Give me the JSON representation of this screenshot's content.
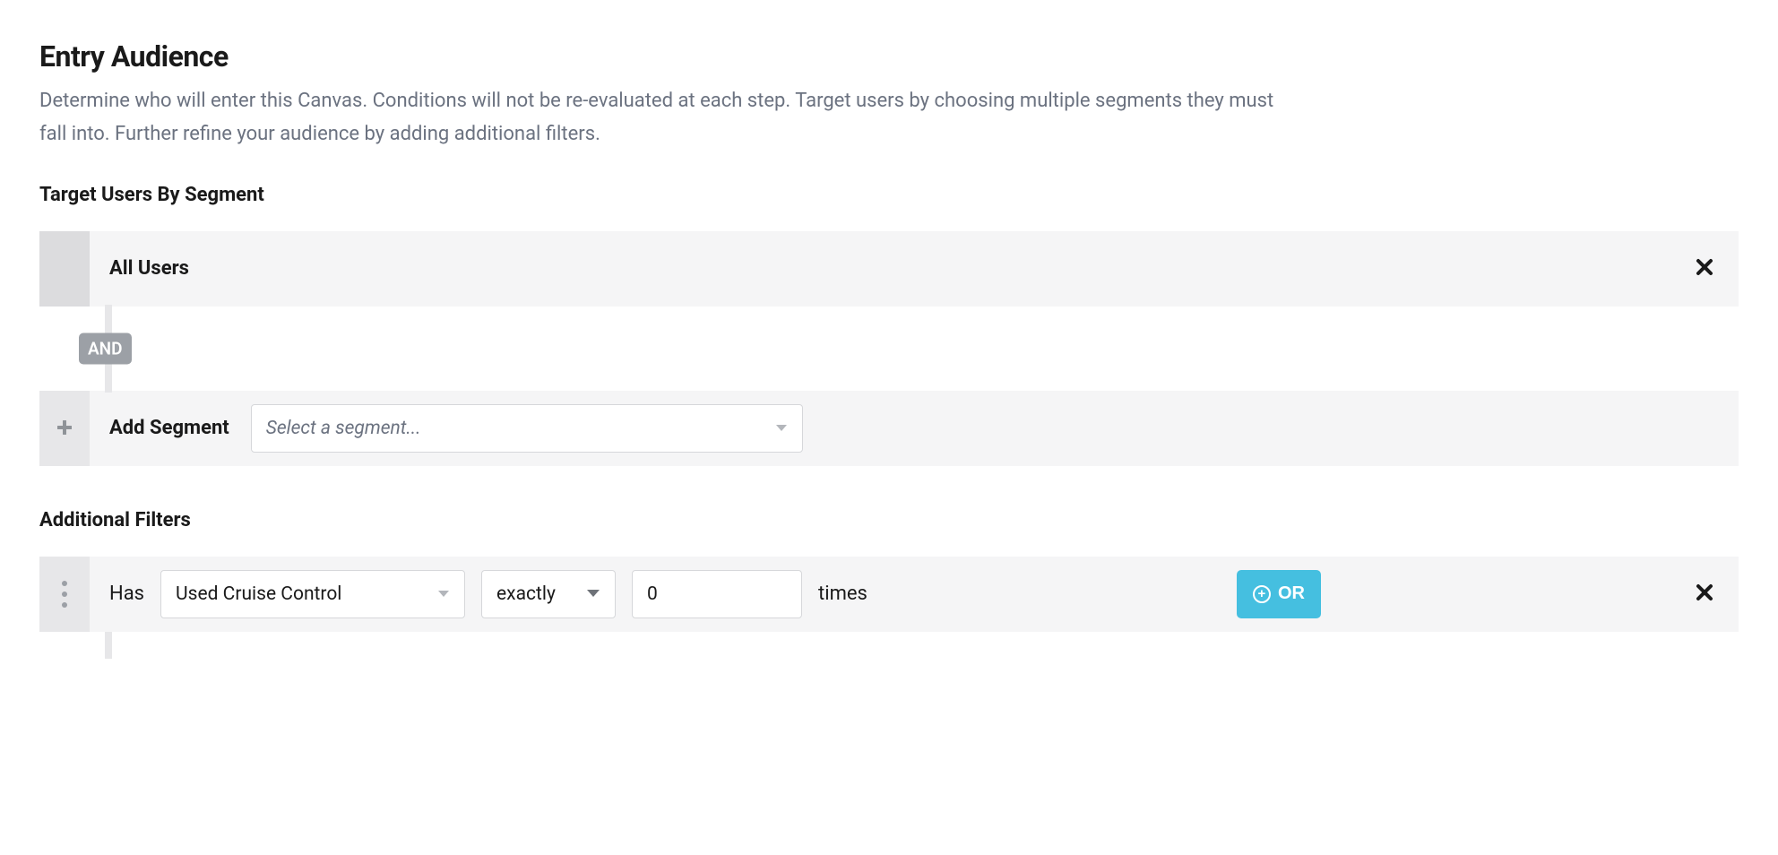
{
  "header": {
    "title": "Entry Audience",
    "description": "Determine who will enter this Canvas. Conditions will not be re-evaluated at each step. Target users by choosing multiple segments they must fall into. Further refine your audience by adding additional filters."
  },
  "segments": {
    "heading": "Target Users By Segment",
    "row1_label": "All Users",
    "connector": "AND",
    "add_label": "Add Segment",
    "select_placeholder": "Select a segment..."
  },
  "filters": {
    "heading": "Additional Filters",
    "prefix": "Has",
    "event_value": "Used Cruise Control",
    "comparator_value": "exactly",
    "count_value": "0",
    "suffix": "times",
    "or_label": "OR"
  }
}
